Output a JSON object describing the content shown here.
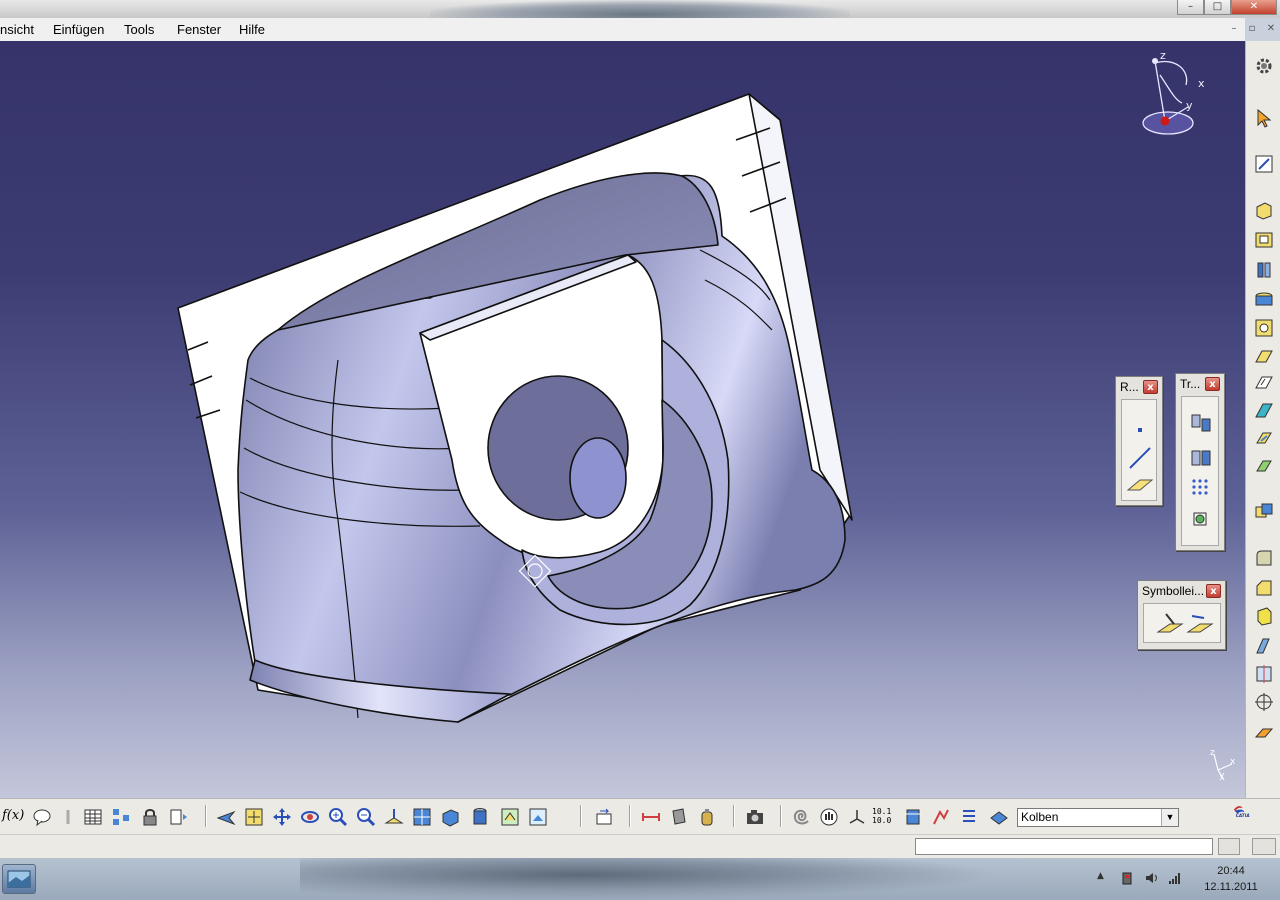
{
  "window": {
    "minimize": "–",
    "maximize": "□",
    "close": "✕"
  },
  "menu": {
    "items": [
      {
        "label": "nsicht"
      },
      {
        "label": "Einfügen"
      },
      {
        "label": "Tools"
      },
      {
        "label": "Fenster"
      },
      {
        "label": "Hilfe"
      }
    ],
    "mdi_min": "–",
    "mdi_restore": "▫",
    "mdi_close": "✕"
  },
  "compass": {
    "x": "x",
    "y": "y",
    "z": "z"
  },
  "axis_triad": {
    "x": "x",
    "y": "y",
    "z": "z"
  },
  "floating_toolbars": {
    "reference": {
      "title": "R...",
      "close": "x"
    },
    "transform": {
      "title": "Tr...",
      "close": "x"
    },
    "symbols": {
      "title": "Symbollei...",
      "close": "x"
    }
  },
  "bottom_toolbar": {
    "formula": "f(x)",
    "zoom_readout": "10.1\n10.0",
    "layer_value": "Kolben",
    "layer_arrow": "▼"
  },
  "catia_logo": "CATIA",
  "taskbar": {
    "time": "20:44",
    "date": "12.11.2011",
    "tray_arrow": "▲"
  },
  "colors": {
    "viewport_top": "#35336a",
    "viewport_bottom": "#c4c7da",
    "part_face": "#ffffff",
    "part_shade": "#b9bde6",
    "close_red": "#c23d2f"
  }
}
